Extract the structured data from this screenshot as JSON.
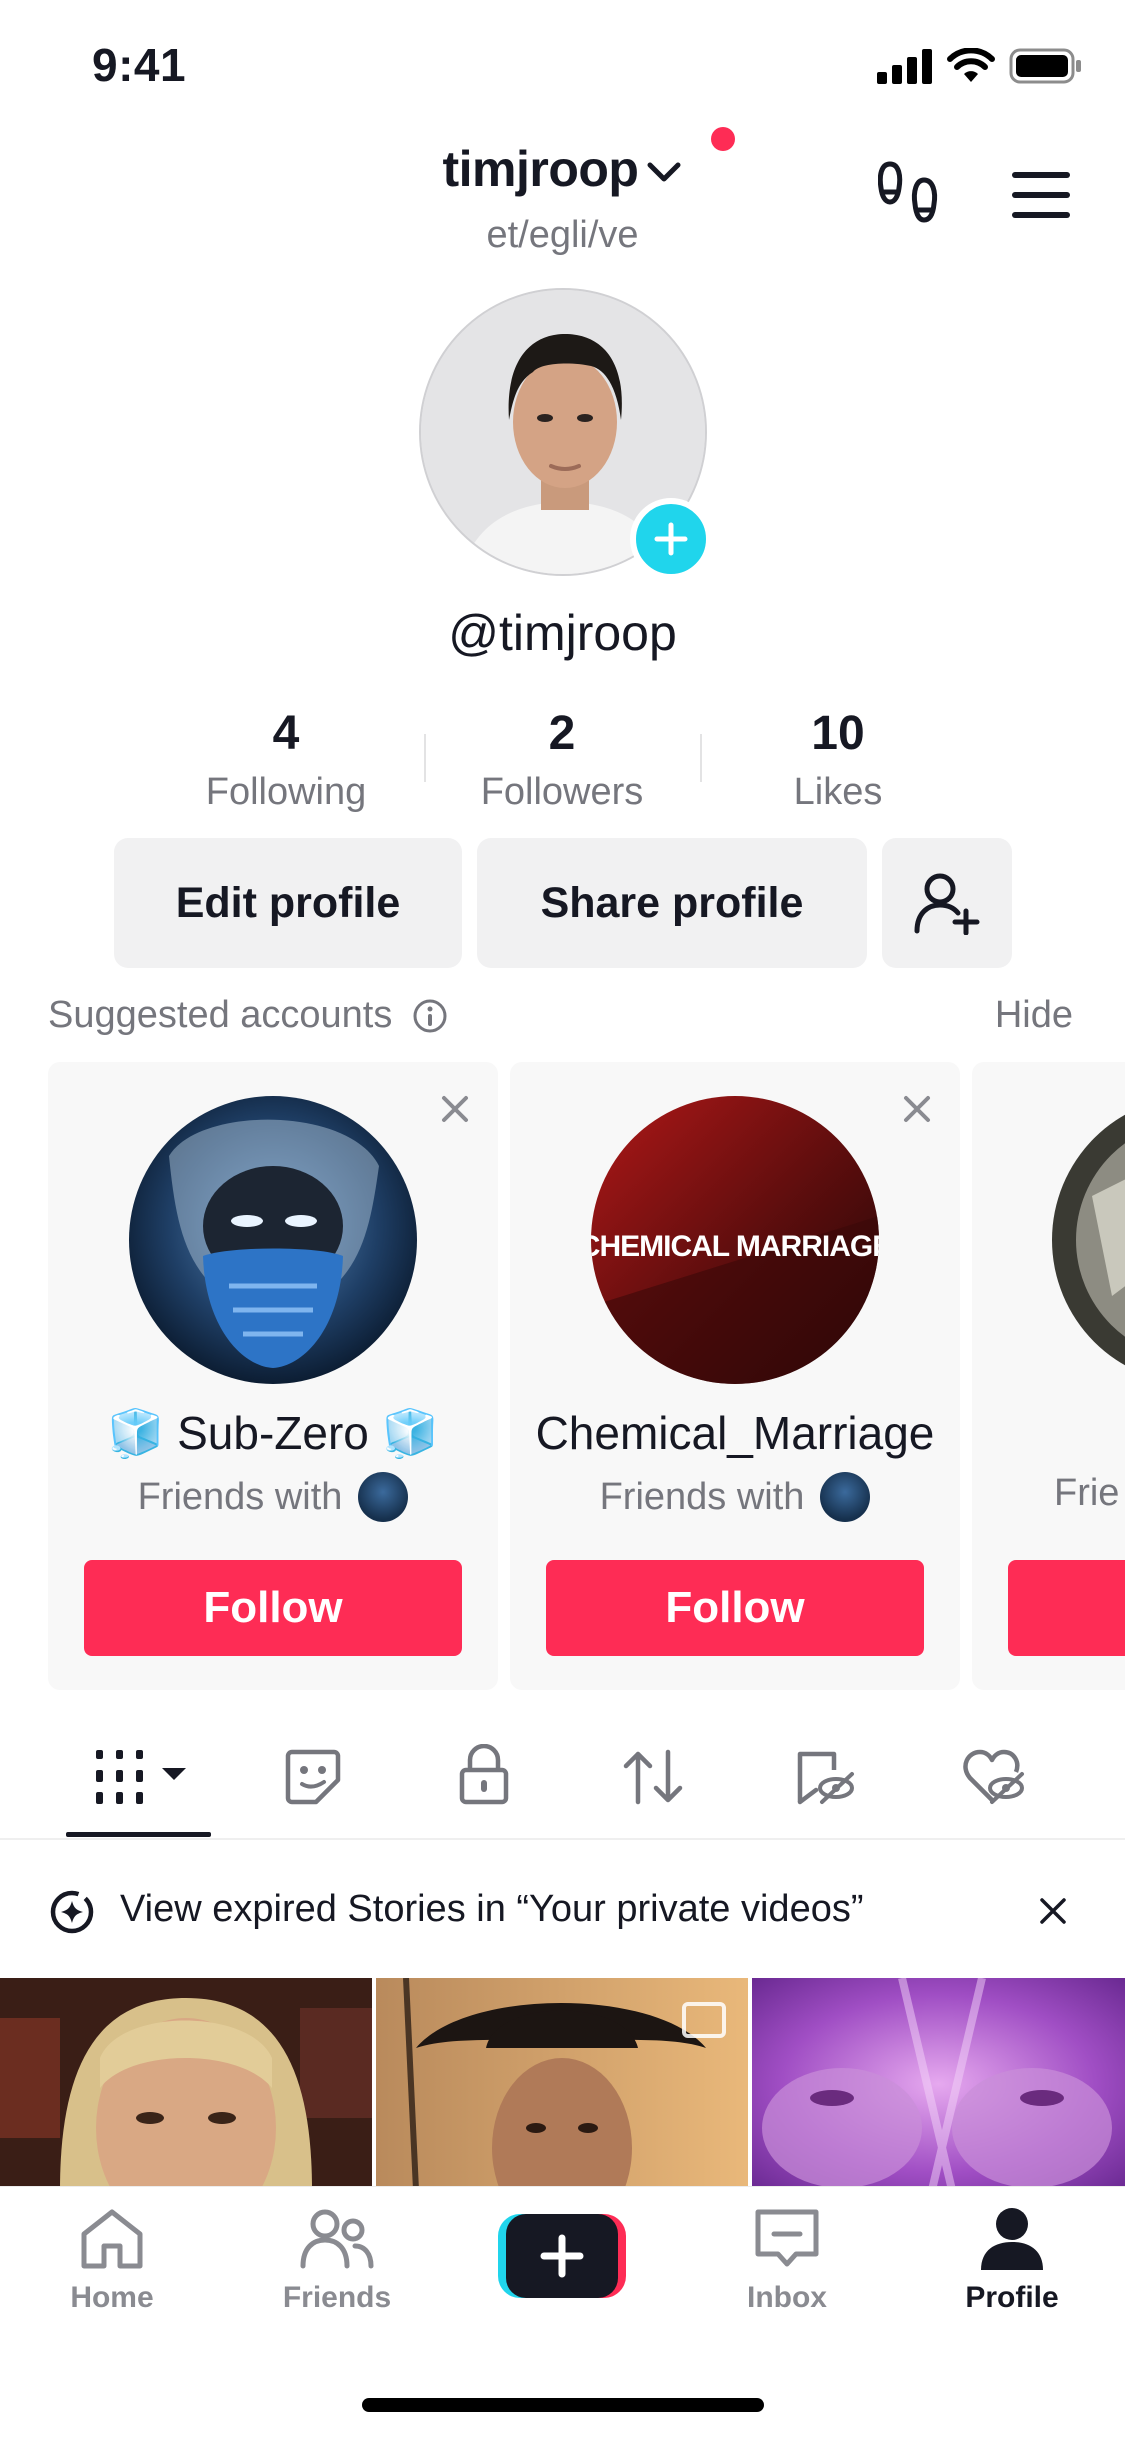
{
  "status_bar": {
    "time": "9:41"
  },
  "header": {
    "username": "timjroop",
    "pronouns": "et/egli/ve",
    "handle": "@timjroop"
  },
  "stats": [
    {
      "value": "4",
      "label": "Following"
    },
    {
      "value": "2",
      "label": "Followers"
    },
    {
      "value": "10",
      "label": "Likes"
    }
  ],
  "actions": {
    "edit_profile": "Edit profile",
    "share_profile": "Share profile"
  },
  "suggested": {
    "title": "Suggested accounts",
    "hide": "Hide",
    "cards": [
      {
        "name": "🧊 Sub-Zero 🧊",
        "friends_with": "Friends with",
        "follow": "Follow"
      },
      {
        "name": "Chemical_Marriage",
        "friends_with": "Friends with",
        "follow": "Follow",
        "logo_text": "CHEMICAL MARRIAGE"
      },
      {
        "friends_with": "Frie"
      }
    ]
  },
  "tabs": [
    "videos-grid",
    "stickers",
    "private",
    "reposts",
    "favorites-hidden",
    "liked-hidden"
  ],
  "banner": {
    "text": "View expired Stories in “Your private videos”"
  },
  "nav": {
    "home": "Home",
    "friends": "Friends",
    "inbox": "Inbox",
    "profile": "Profile"
  },
  "colors": {
    "accent": "#fe2c55",
    "cyan": "#20d5ec",
    "text": "#161823",
    "muted": "#75767d"
  }
}
